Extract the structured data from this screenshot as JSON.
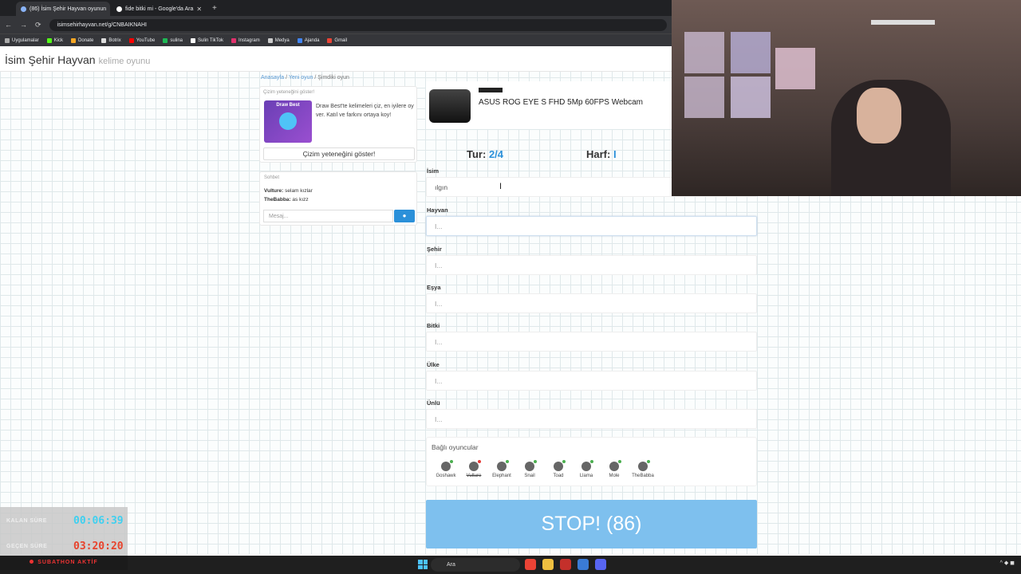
{
  "browser": {
    "tabs": [
      {
        "label": "(86) İsim Şehir Hayvan oyunun"
      },
      {
        "label": "fide bitki mi - Google'da Ara"
      }
    ],
    "url": "isimsehirhayvan.net/g/CNBAIKNAHI",
    "bookmarks": [
      "Uygulamalar",
      "Kick",
      "Donate",
      "Botrix",
      "YouTube",
      "sulina",
      "Sulin TikTok",
      "Instagram",
      "Medya",
      "Ajanda",
      "Gmail"
    ]
  },
  "site": {
    "title": "İsim Şehir Hayvan",
    "subtitle": "kelime oyunu"
  },
  "breadcrumb": [
    "Anasayfa",
    "Yeni oyun",
    "Şimdiki oyun"
  ],
  "draw": {
    "header": "Çizim yeteneğini göster!",
    "image_label": "Draw Best",
    "text": "Draw Best'te kelimeleri çiz, en iyilere oy ver. Katıl ve farkını ortaya koy!",
    "button": "Çizim yeteneğini göster!"
  },
  "chat": {
    "header": "Sohbet",
    "messages": [
      {
        "user": "Vulture:",
        "text": "selam kızlar"
      },
      {
        "user": "TheBabba:",
        "text": "as kızz"
      }
    ],
    "placeholder": "Mesaj..."
  },
  "ad": {
    "title": "ASUS ROG EYE S FHD 5Mp 60FPS Webcam"
  },
  "game": {
    "round_label": "Tur:",
    "round_value": "2/4",
    "letter_label": "Harf:",
    "letter_value": "I",
    "fields": [
      {
        "label": "İsim",
        "value": "ılgın",
        "placeholder": "I..."
      },
      {
        "label": "Hayvan",
        "value": "",
        "placeholder": "I..."
      },
      {
        "label": "Şehir",
        "value": "",
        "placeholder": "I..."
      },
      {
        "label": "Eşya",
        "value": "",
        "placeholder": "I..."
      },
      {
        "label": "Bitki",
        "value": "",
        "placeholder": "I..."
      },
      {
        "label": "Ülke",
        "value": "",
        "placeholder": "I..."
      },
      {
        "label": "Ünlü",
        "value": "",
        "placeholder": "I..."
      }
    ],
    "players_header": "Bağlı oyuncular",
    "players": [
      "Goshawk",
      "Vulture",
      "Elephant",
      "Snail",
      "Toad",
      "Llama",
      "Mole",
      "TheBabba"
    ],
    "stop_button": "STOP! (86)"
  },
  "overlay": {
    "remaining_label": "KALAN SÜRE",
    "remaining_value": "00:06:39",
    "elapsed_label": "GEÇEN SÜRE",
    "elapsed_value": "03:20:20",
    "banner": "SUBATHON AKTİF"
  },
  "colors": {
    "accent": "#2b90d9",
    "stop": "#7ec0ee",
    "remaining": "#3fd0f0",
    "elapsed": "#e8432c"
  },
  "taskbar": {
    "search_label": "Ara"
  }
}
